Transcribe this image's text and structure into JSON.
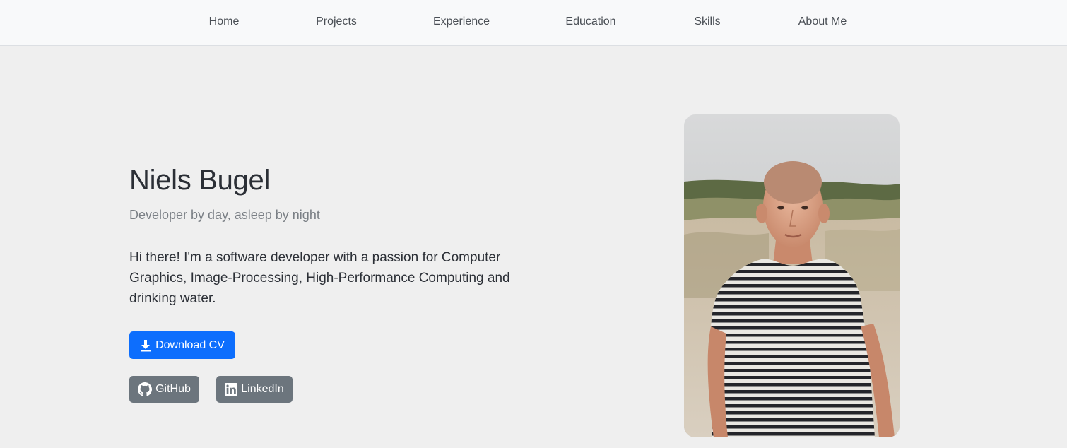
{
  "nav": {
    "items": [
      {
        "label": "Home"
      },
      {
        "label": "Projects"
      },
      {
        "label": "Experience"
      },
      {
        "label": "Education"
      },
      {
        "label": "Skills"
      },
      {
        "label": "About Me"
      }
    ]
  },
  "hero": {
    "name": "Niels Bugel",
    "tagline": "Developer by day, asleep by night",
    "intro": "Hi there! I'm a software developer with a passion for Computer Graphics, Image-Processing, High-Performance Computing and drinking water.",
    "download_cv_label": "Download CV",
    "download_icon": "download-icon",
    "github_label": "GitHub",
    "github_icon": "github-icon",
    "linkedin_label": "LinkedIn",
    "linkedin_icon": "linkedin-icon",
    "photo_alt": "Niels Bugel"
  },
  "colors": {
    "primary": "#0d6efd",
    "secondary": "#6c757d",
    "background": "#efefef",
    "navbar": "#f8f9fa"
  }
}
